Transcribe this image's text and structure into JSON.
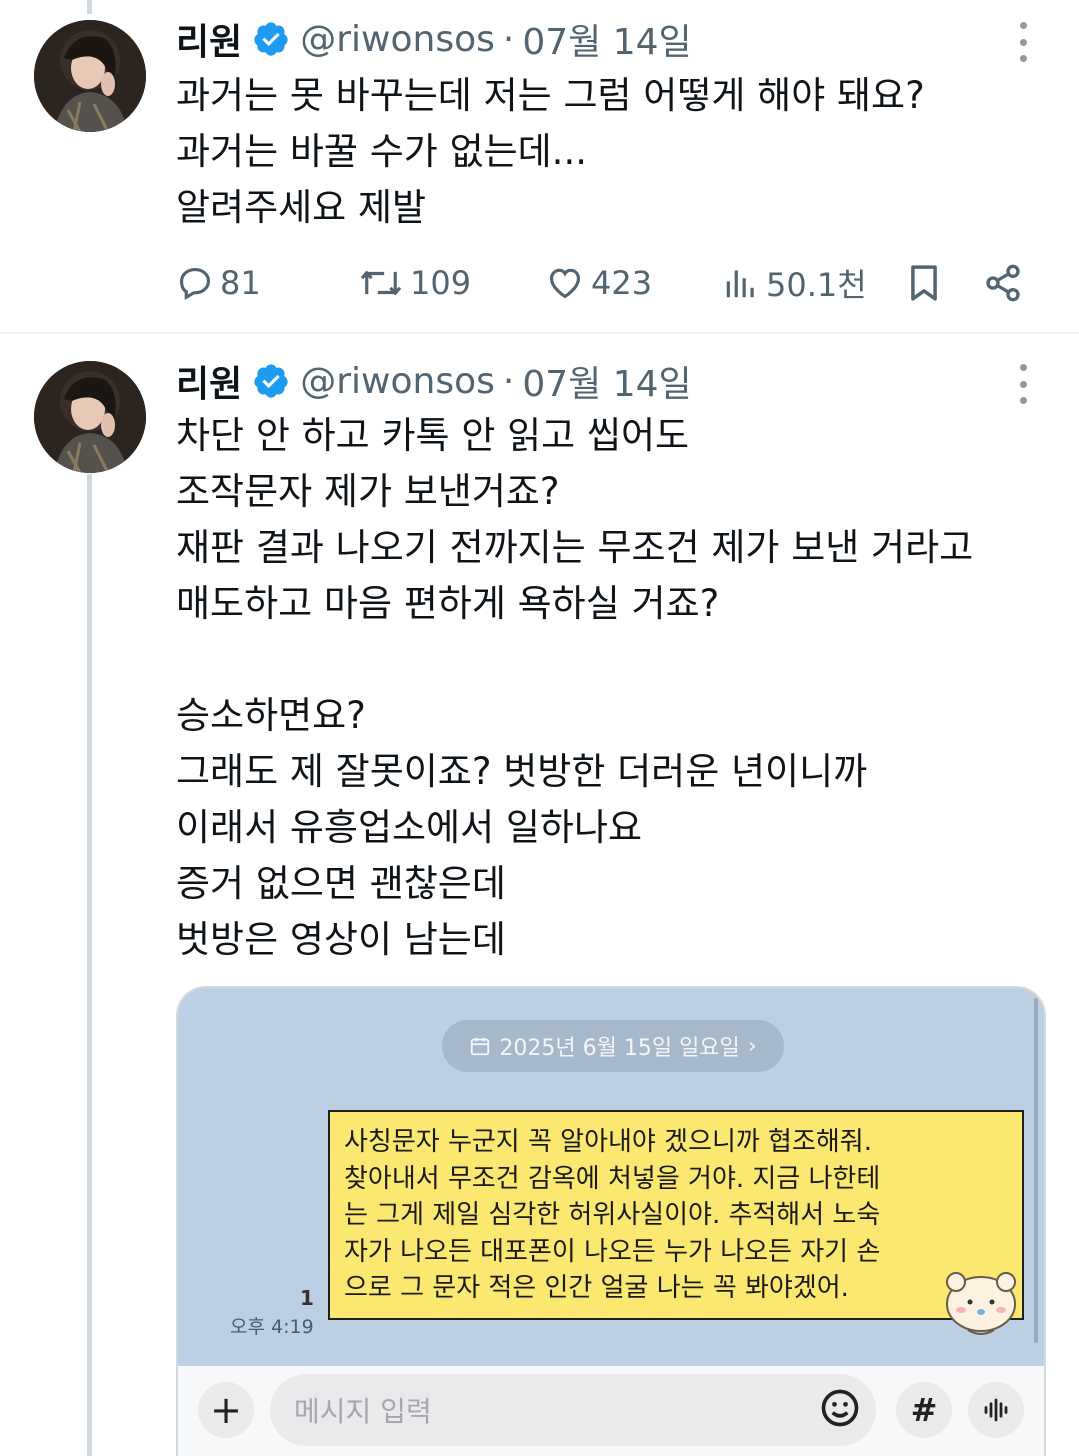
{
  "tweets": [
    {
      "author_name": "리원",
      "handle": "@riwonsos",
      "separator": "·",
      "date": "07월 14일",
      "text": "과거는 못 바꾸는데 저는 그럼 어떻게 해야 돼요?\n과거는 바꿀 수가 없는데...\n알려주세요 제발",
      "replies": "81",
      "reposts": "109",
      "likes": "423",
      "views": "50.1천"
    },
    {
      "author_name": "리원",
      "handle": "@riwonsos",
      "separator": "·",
      "date": "07월 14일",
      "text": "차단 안 하고 카톡 안 읽고 씹어도\n조작문자 제가 보낸거죠?\n재판 결과 나오기 전까지는 무조건 제가 보낸 거라고\n매도하고 마음 편하게 욕하실 거죠?\n\n승소하면요?\n그래도 제 잘못이죠? 벗방한 더러운 년이니까\n이래서 유흥업소에서 일하나요\n증거 없으면 괜찮은데\n벗방은 영상이 남는데"
    }
  ],
  "chat": {
    "date_pill": "2025년 6월 15일 일요일",
    "message": "사칭문자 누군지 꼭 알아내야 겠으니까 협조해줘.\n찾아내서 무조건 감옥에 처넣을 거야. 지금 나한테\n는 그게 제일 심각한 허위사실이야. 추적해서 노숙\n자가 나오든 대포폰이 나오든 누가 나오든 자기 손\n으로 그 문자 적은 인간 얼굴 나는 꼭 봐야겠어.",
    "read_count": "1",
    "time": "오후 4:19",
    "input_placeholder": "메시지 입력",
    "plus_label": "+",
    "hash_label": "#"
  },
  "colors": {
    "verified": "#1d9bf0",
    "muted": "#536471",
    "chat_bg": "#bccfe3",
    "bubble": "#fbe870"
  }
}
